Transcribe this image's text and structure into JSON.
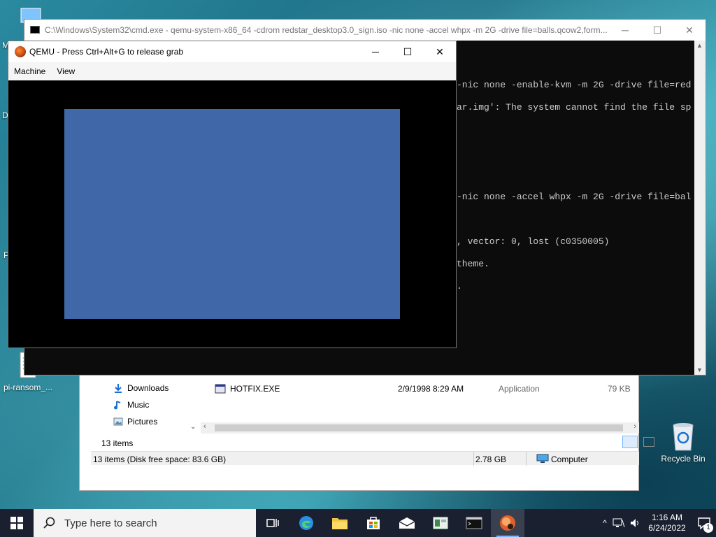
{
  "desktop": {
    "icons": [
      {
        "label": "pi-ransom_..."
      },
      {
        "label": "Recycle Bin"
      }
    ],
    "edge_fragments": [
      "M",
      "D",
      "P"
    ]
  },
  "explorer": {
    "nav": [
      "Downloads",
      "Music",
      "Pictures"
    ],
    "rows": [
      {
        "name": "HOTFIX.EXE",
        "date": "2/9/1998 8:29 AM",
        "type": "Application",
        "size": "79 KB"
      }
    ],
    "items_count": "13 items",
    "status_left": "13 items (Disk free space: 83.6 GB)",
    "status_size": "2.78 GB",
    "status_location": "Computer"
  },
  "cmd": {
    "title": "C:\\Windows\\System32\\cmd.exe - qemu-system-x86_64  -cdrom redstar_desktop3.0_sign.iso -nic none -accel whpx -m 2G -drive file=balls.qcow2,form...",
    "lines": [
      "-nic none -enable-kvm -m 2G -drive file=red",
      "ar.img': The system cannot find the file sp",
      "",
      "",
      "",
      "-nic none -accel whpx -m 2G -drive file=bal",
      "",
      ", vector: 0, lost (c0350005)",
      "theme.",
      "."
    ]
  },
  "qemu": {
    "title": "QEMU - Press Ctrl+Alt+G to release grab",
    "menu": [
      "Machine",
      "View"
    ],
    "screen_color": "#4068a8"
  },
  "taskbar": {
    "search_placeholder": "Type here to search",
    "time": "1:16 AM",
    "date": "6/24/2022",
    "notification_count": "1"
  }
}
